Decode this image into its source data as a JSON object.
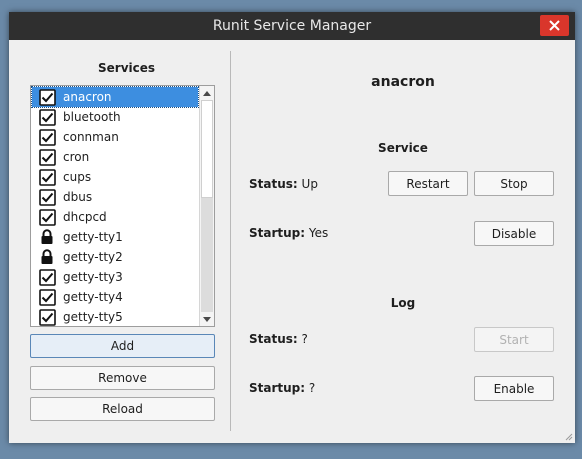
{
  "window": {
    "title": "Runit Service Manager"
  },
  "services_panel": {
    "heading": "Services",
    "items": [
      {
        "name": "anacron",
        "icon": "checkbox-checked-icon",
        "selected": true
      },
      {
        "name": "bluetooth",
        "icon": "checkbox-checked-icon"
      },
      {
        "name": "connman",
        "icon": "checkbox-checked-icon"
      },
      {
        "name": "cron",
        "icon": "checkbox-checked-icon"
      },
      {
        "name": "cups",
        "icon": "checkbox-checked-icon"
      },
      {
        "name": "dbus",
        "icon": "checkbox-checked-icon"
      },
      {
        "name": "dhcpcd",
        "icon": "checkbox-checked-icon"
      },
      {
        "name": "getty-tty1",
        "icon": "lock-icon"
      },
      {
        "name": "getty-tty2",
        "icon": "lock-icon"
      },
      {
        "name": "getty-tty3",
        "icon": "checkbox-checked-icon"
      },
      {
        "name": "getty-tty4",
        "icon": "checkbox-checked-icon"
      },
      {
        "name": "getty-tty5",
        "icon": "checkbox-checked-icon"
      }
    ],
    "add_label": "Add",
    "remove_label": "Remove",
    "reload_label": "Reload"
  },
  "detail": {
    "service_name": "anacron",
    "service_section": {
      "heading": "Service",
      "status_label": "Status:",
      "status_value": "Up",
      "restart_label": "Restart",
      "stop_label": "Stop",
      "startup_label": "Startup:",
      "startup_value": "Yes",
      "disable_label": "Disable"
    },
    "log_section": {
      "heading": "Log",
      "status_label": "Status:",
      "status_value": "?",
      "start_label": "Start",
      "startup_label": "Startup:",
      "startup_value": "?",
      "enable_label": "Enable"
    }
  }
}
